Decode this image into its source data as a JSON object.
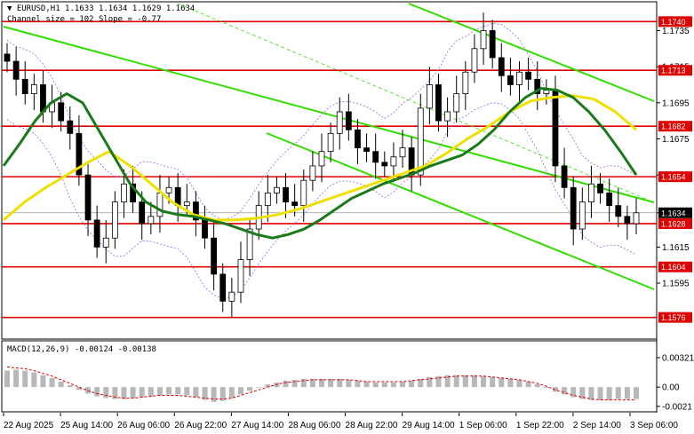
{
  "header": {
    "symbol_line": "EURUSD,H1  1.1633 1.1634 1.1629 1.1634",
    "indicator_line": "Channel size = 102 Slope = -0.77"
  },
  "macd_label": "MACD(12,26,9) -0.00124 -0.00138",
  "colors": {
    "bull": "#ffffff",
    "bear": "#000000",
    "level": "#e00000",
    "sma_fast": "#1a7a1a",
    "sma_slow": "#f0e000",
    "channel": "#33dd00",
    "bands": "#a060e0",
    "macd_hist": "#b8b8b8",
    "macd_signal": "#e00000"
  },
  "chart_data": [
    {
      "type": "candlestick",
      "title": "EURUSD,H1",
      "ylim": [
        1.1565,
        1.175
      ],
      "y_ticks": [
        "1.1735",
        "1.1715",
        "1.1695",
        "1.1675",
        "1.1655",
        "1.1634",
        "1.1615",
        "1.1595"
      ],
      "x_ticks": [
        "22 Aug 2025",
        "25 Aug 14:00",
        "26 Aug 06:00",
        "26 Aug 22:00",
        "27 Aug 14:00",
        "28 Aug 06:00",
        "28 Aug 22:00",
        "29 Aug 14:00",
        "1 Sep 06:00",
        "1 Sep 22:00",
        "2 Sep 14:00",
        "3 Sep 06:00"
      ],
      "levels": [
        {
          "value": 1.174,
          "label": "1.1740"
        },
        {
          "value": 1.1713,
          "label": "1.1713"
        },
        {
          "value": 1.1682,
          "label": "1.1682"
        },
        {
          "value": 1.1654,
          "label": "1.1654"
        },
        {
          "value": 1.1628,
          "label": "1.1628"
        },
        {
          "value": 1.1604,
          "label": "1.1604"
        },
        {
          "value": 1.1576,
          "label": "1.1576"
        }
      ],
      "current_price": {
        "value": 1.1634,
        "label": "1.1634"
      },
      "candles_close": [
        1.1718,
        1.1708,
        1.17,
        1.1705,
        1.169,
        1.1695,
        1.1685,
        1.1678,
        1.1655,
        1.163,
        1.1615,
        1.162,
        1.164,
        1.165,
        1.164,
        1.1628,
        1.1632,
        1.1645,
        1.1648,
        1.1638,
        1.164,
        1.163,
        1.162,
        1.16,
        1.1585,
        1.159,
        1.1608,
        1.1625,
        1.1638,
        1.1645,
        1.1648,
        1.164,
        1.1638,
        1.1652,
        1.166,
        1.1668,
        1.1678,
        1.169,
        1.168,
        1.167,
        1.1668,
        1.1662,
        1.166,
        1.1665,
        1.167,
        1.1655,
        1.1692,
        1.1705,
        1.1685,
        1.169,
        1.17,
        1.1712,
        1.1725,
        1.1735,
        1.172,
        1.171,
        1.1705,
        1.1712,
        1.1708,
        1.17,
        1.1702,
        1.166,
        1.1648,
        1.1625,
        1.164,
        1.165,
        1.1645,
        1.1638,
        1.1632,
        1.1628,
        1.1634
      ],
      "sma_fast": [
        1.166,
        1.1672,
        1.1685,
        1.1695,
        1.17,
        1.1695,
        1.168,
        1.1665,
        1.165,
        1.164,
        1.1635,
        1.1633,
        1.1632,
        1.163,
        1.1628,
        1.1625,
        1.1622,
        1.162,
        1.1622,
        1.1625,
        1.163,
        1.1636,
        1.1642,
        1.1646,
        1.165,
        1.1653,
        1.1656,
        1.166,
        1.1663,
        1.1666,
        1.1672,
        1.168,
        1.169,
        1.1698,
        1.1703,
        1.1702,
        1.1698,
        1.169,
        1.168,
        1.1668,
        1.1655
      ],
      "sma_slow": [
        1.163,
        1.164,
        1.1648,
        1.1655,
        1.1662,
        1.1668,
        1.166,
        1.165,
        1.164,
        1.1633,
        1.163,
        1.163,
        1.1631,
        1.1633,
        1.1636,
        1.164,
        1.1644,
        1.1648,
        1.1652,
        1.1656,
        1.166,
        1.1667,
        1.1675,
        1.1682,
        1.169,
        1.1696,
        1.1698,
        1.1699,
        1.1697,
        1.169,
        1.168
      ],
      "macd": {
        "ylim": [
          -0.0025,
          0.0035
        ],
        "y_ticks": [
          "0.00321",
          "0.00",
          "-0.0021"
        ],
        "histogram": [
          0.0018,
          0.0019,
          0.0018,
          0.0016,
          0.0013,
          0.001,
          0.0006,
          0.0002,
          -0.0003,
          -0.0007,
          -0.001,
          -0.0012,
          -0.0013,
          -0.0013,
          -0.0012,
          -0.0011,
          -0.001,
          -0.0009,
          -0.0008,
          -0.0008,
          -0.0009,
          -0.0011,
          -0.0014,
          -0.0016,
          -0.0015,
          -0.0012,
          -0.0008,
          -0.0004,
          0.0,
          0.0003,
          0.0005,
          0.0007,
          0.0008,
          0.0009,
          0.0009,
          0.0009,
          0.0009,
          0.0009,
          0.0008,
          0.0007,
          0.0006,
          0.0005,
          0.0005,
          0.0005,
          0.0006,
          0.0007,
          0.0009,
          0.0011,
          0.0012,
          0.0013,
          0.0013,
          0.0013,
          0.0013,
          0.0012,
          0.0011,
          0.001,
          0.0009,
          0.0008,
          0.0006,
          0.0003,
          -0.0001,
          -0.0005,
          -0.0008,
          -0.0011,
          -0.0013,
          -0.0014,
          -0.0014,
          -0.0014,
          -0.0013,
          -0.0013,
          -0.0013
        ],
        "signal": [
          0.0022,
          0.0021,
          0.002,
          0.0018,
          0.0015,
          0.0012,
          0.0008,
          0.0004,
          0.0,
          -0.0004,
          -0.0007,
          -0.0009,
          -0.0011,
          -0.0012,
          -0.0012,
          -0.0011,
          -0.001,
          -0.0009,
          -0.0009,
          -0.0009,
          -0.001,
          -0.0011,
          -0.0012,
          -0.0013,
          -0.0013,
          -0.0012,
          -0.0009,
          -0.0006,
          -0.0003,
          0.0,
          0.0003,
          0.0005,
          0.0006,
          0.0007,
          0.0008,
          0.0008,
          0.0008,
          0.0008,
          0.0008,
          0.0007,
          0.0006,
          0.0006,
          0.0006,
          0.0006,
          0.0006,
          0.0007,
          0.0008,
          0.0009,
          0.001,
          0.0011,
          0.0012,
          0.0012,
          0.0012,
          0.0012,
          0.0011,
          0.001,
          0.0009,
          0.0008,
          0.0006,
          0.0004,
          0.0001,
          -0.0003,
          -0.0006,
          -0.0009,
          -0.0011,
          -0.0013,
          -0.0014,
          -0.0014,
          -0.0014,
          -0.0014,
          -0.0014
        ]
      }
    }
  ]
}
